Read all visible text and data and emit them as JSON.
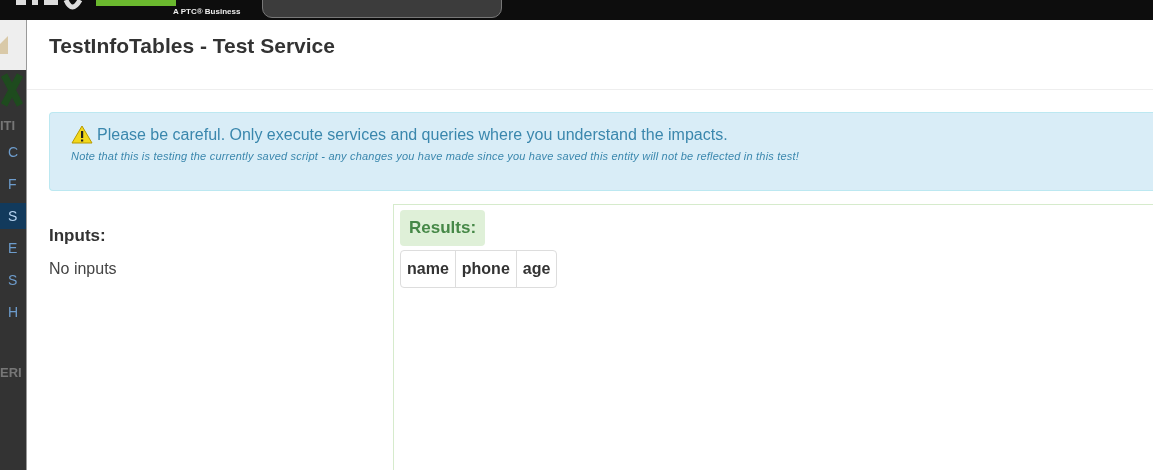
{
  "header": {
    "tagline": "A PTC® Business"
  },
  "sidebar": {
    "heading": "ITI",
    "items": [
      {
        "label": "C",
        "selected": false
      },
      {
        "label": "F",
        "selected": false
      },
      {
        "label": "S",
        "selected": true
      },
      {
        "label": "E",
        "selected": false
      },
      {
        "label": "S",
        "selected": false
      },
      {
        "label": "H",
        "selected": false
      }
    ],
    "footer": "ERI"
  },
  "dialog": {
    "title": "TestInfoTables - Test Service",
    "alert": {
      "message": "Please be careful. Only execute services and queries where you understand the impacts.",
      "note": "Note that this is testing the currently saved script - any changes you have made since you have saved this entity will not be reflected in this test!"
    },
    "inputs": {
      "heading": "Inputs:",
      "empty_text": "No inputs"
    },
    "results": {
      "heading": "Results:",
      "columns": [
        "name",
        "phone",
        "age"
      ]
    }
  }
}
